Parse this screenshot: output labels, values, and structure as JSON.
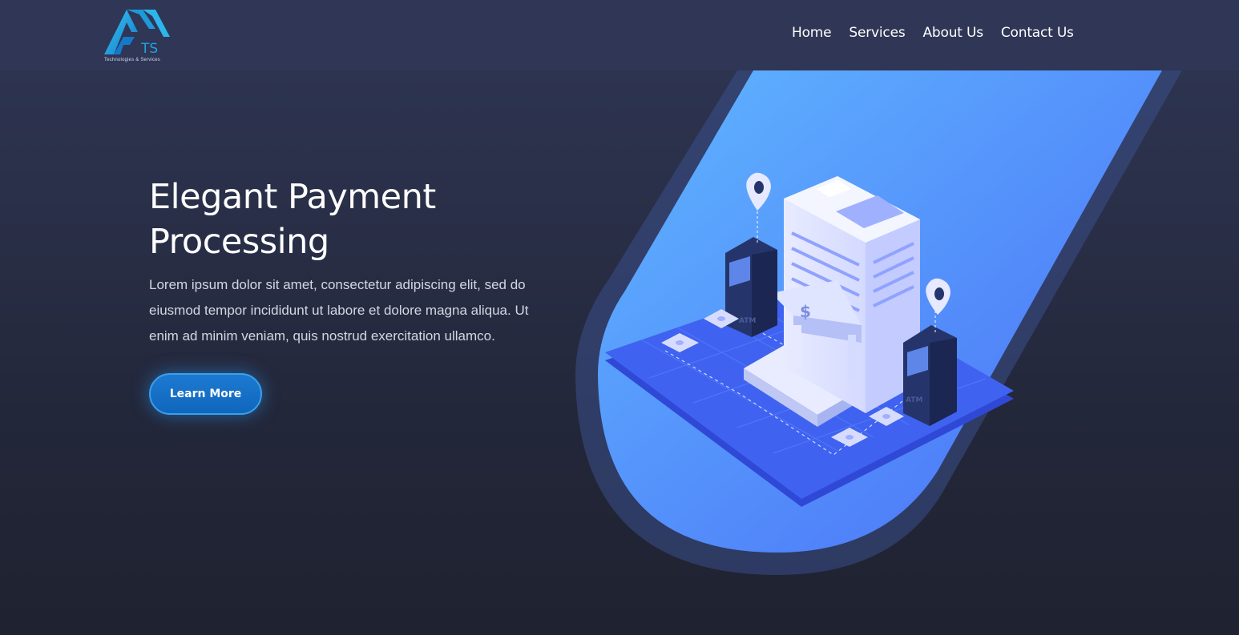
{
  "logo": {
    "letters": "TS",
    "tagline": "Technologies & Services"
  },
  "nav": {
    "items": [
      {
        "label": "Home"
      },
      {
        "label": "Services"
      },
      {
        "label": "About Us"
      },
      {
        "label": "Contact Us"
      }
    ]
  },
  "hero": {
    "title": "Elegant Payment Processing",
    "description": "Lorem ipsum dolor sit amet, consectetur adipiscing elit, sed do eiusmod tempor incididunt ut labore et dolore magna aliqua. Ut enim ad minim veniam, quis nostrud exercitation ullamco.",
    "cta_label": "Learn More"
  },
  "illustration": {
    "atm_label": "ATM",
    "currency_symbol": "$"
  },
  "colors": {
    "background": "#2a3049",
    "navbar": "#2f3656",
    "accent": "#1d7ad0",
    "logo_cyan": "#1fa3e0",
    "panel_blue": "#4f8cff"
  }
}
